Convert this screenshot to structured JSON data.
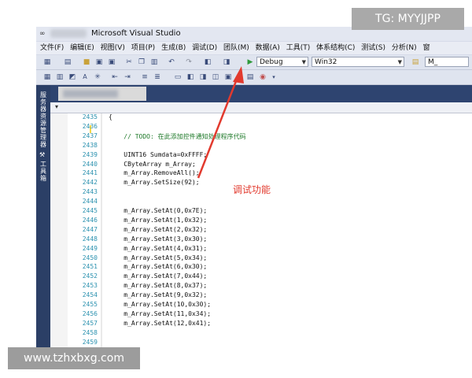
{
  "window": {
    "logo": "∞",
    "title": "Microsoft Visual Studio"
  },
  "menu": {
    "items": [
      "文件(F)",
      "编辑(E)",
      "视图(V)",
      "项目(P)",
      "生成(B)",
      "调试(D)",
      "团队(M)",
      "数据(A)",
      "工具(T)",
      "体系结构(C)",
      "测试(S)",
      "分析(N)",
      "窗"
    ]
  },
  "toolbar": {
    "config": "Debug",
    "platform": "Win32",
    "extra": "M_",
    "start_icon": "play-icon"
  },
  "side_panels": {
    "top": "服务器资源管理器",
    "bottom": "工具箱"
  },
  "editor": {
    "lines": [
      {
        "num": "2435",
        "text": "{"
      },
      {
        "num": "2436",
        "text": ""
      },
      {
        "num": "2437",
        "text": "    // TODO: 在此添加控件通知处理程序代码"
      },
      {
        "num": "2438",
        "text": ""
      },
      {
        "num": "2439",
        "text": "    UINT16 Sumdata=0xFFFF;"
      },
      {
        "num": "2440",
        "text": "    CByteArray m_Array;"
      },
      {
        "num": "2441",
        "text": "    m_Array.RemoveAll();"
      },
      {
        "num": "2442",
        "text": "    m_Array.SetSize(92);"
      },
      {
        "num": "2443",
        "text": ""
      },
      {
        "num": "2444",
        "text": ""
      },
      {
        "num": "2445",
        "text": "    m_Array.SetAt(0,0x7E);"
      },
      {
        "num": "2446",
        "text": "    m_Array.SetAt(1,0x32);"
      },
      {
        "num": "2447",
        "text": "    m_Array.SetAt(2,0x32);"
      },
      {
        "num": "2448",
        "text": "    m_Array.SetAt(3,0x30);"
      },
      {
        "num": "2449",
        "text": "    m_Array.SetAt(4,0x31);"
      },
      {
        "num": "2450",
        "text": "    m_Array.SetAt(5,0x34);"
      },
      {
        "num": "2451",
        "text": "    m_Array.SetAt(6,0x30);"
      },
      {
        "num": "2452",
        "text": "    m_Array.SetAt(7,0x44);"
      },
      {
        "num": "2453",
        "text": "    m_Array.SetAt(8,0x37);"
      },
      {
        "num": "2454",
        "text": "    m_Array.SetAt(9,0x32);"
      },
      {
        "num": "2455",
        "text": "    m_Array.SetAt(10,0x30);"
      },
      {
        "num": "2456",
        "text": "    m_Array.SetAt(11,0x34);"
      },
      {
        "num": "2457",
        "text": "    m_Array.SetAt(12,0x41);"
      },
      {
        "num": "2458",
        "text": ""
      },
      {
        "num": "2459",
        "text": ""
      }
    ]
  },
  "annotation": {
    "label": "调试功能",
    "color": "#e23a2e"
  },
  "watermarks": {
    "top": "TG: MYYJJPP",
    "bottom": "www.tzhxbxg.com"
  }
}
